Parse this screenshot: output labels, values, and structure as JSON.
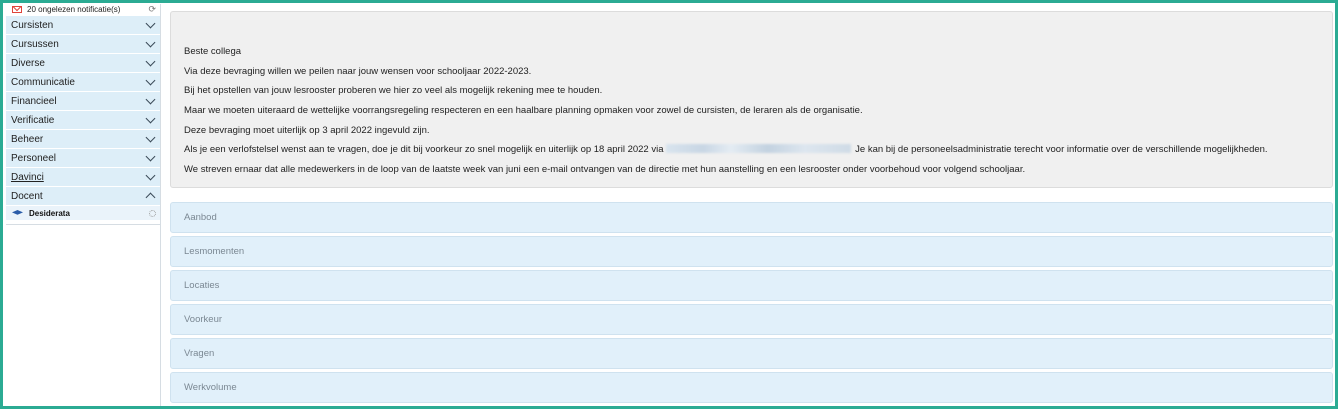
{
  "notifications": {
    "text": "20 ongelezen notificatie(s)",
    "icon": "envelope-icon",
    "refresh_icon": "refresh-icon"
  },
  "sidebar": {
    "items": [
      {
        "label": "Cursisten"
      },
      {
        "label": "Cursussen"
      },
      {
        "label": "Diverse"
      },
      {
        "label": "Communicatie"
      },
      {
        "label": "Financieel"
      },
      {
        "label": "Verificatie"
      },
      {
        "label": "Beheer"
      },
      {
        "label": "Personeel"
      },
      {
        "label": "Davinci"
      },
      {
        "label": "Docent"
      }
    ],
    "expanded": "Docent",
    "sub_items": [
      {
        "label": "Desiderata",
        "icon": "graduation-cap-icon"
      }
    ]
  },
  "message": {
    "lines": [
      "Beste collega",
      "Via deze bevraging willen we peilen naar jouw wensen voor schooljaar 2022-2023.",
      "Bij het opstellen van jouw lesrooster proberen we hier zo veel als mogelijk rekening mee te houden.",
      "Maar we moeten uiteraard de wettelijke voorrangsregeling respecteren en een haalbare planning opmaken voor zowel de cursisten, de leraren als de organisatie.",
      "Deze bevraging moet uiterlijk op 3 april 2022 ingevuld zijn."
    ],
    "line6_before": "Als je een verlofstelsel wenst aan te vragen, doe je dit bij voorkeur zo snel mogelijk en uiterlijk op 18 april 2022 via",
    "line6_after": "Je kan bij de personeelsadministratie terecht voor informatie over de verschillende mogelijkheden.",
    "line7": "We  streven ernaar dat alle medewerkers in de loop van de laatste week van juni een e-mail ontvangen van de directie met hun aanstelling en een lesrooster onder voorbehoud voor volgend schooljaar."
  },
  "sections": [
    {
      "label": "Aanbod"
    },
    {
      "label": "Lesmomenten"
    },
    {
      "label": "Locaties"
    },
    {
      "label": "Voorkeur"
    },
    {
      "label": "Vragen"
    },
    {
      "label": "Werkvolume"
    }
  ],
  "colors": {
    "frame": "#2bab93",
    "nav_bg": "#ddeef8",
    "section_bg": "#e1f0fa",
    "message_bg": "#f0f0f0"
  }
}
